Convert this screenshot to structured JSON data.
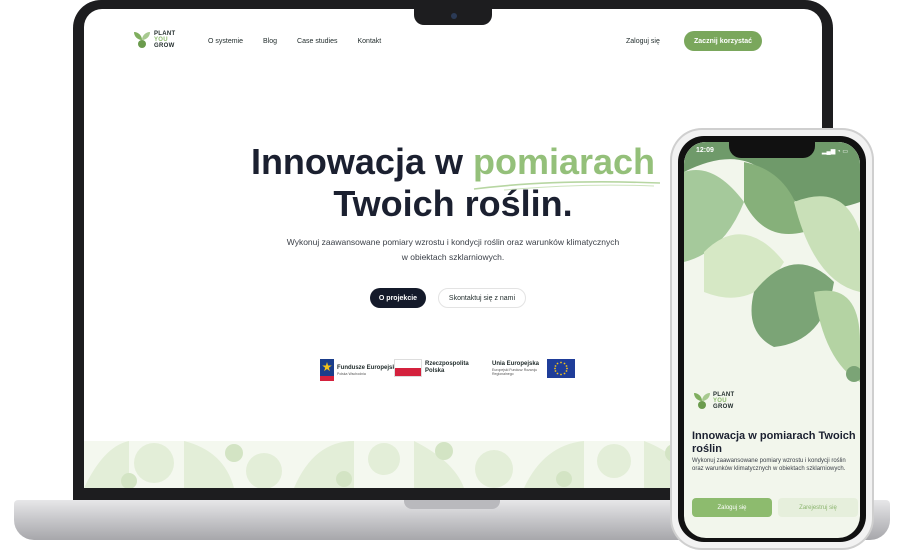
{
  "brand": {
    "line1": "PLANT",
    "line2": "YOU",
    "line3": "GROW"
  },
  "nav": {
    "items": [
      "O systemie",
      "Blog",
      "Case studies",
      "Kontakt"
    ],
    "login": "Zaloguj się",
    "cta": "Zacznij korzystać"
  },
  "hero": {
    "title_part1": "Innowacja w ",
    "title_accent": "pomiarach",
    "title_line2": "Twoich roślin.",
    "subtitle": "Wykonuj zaawansowane pomiary wzrostu i kondycji roślin oraz warunków klimatycznych w obiektach szklarniowych.",
    "primary_button": "O projekcie",
    "secondary_button": "Skontaktuj się z nami"
  },
  "funding": {
    "fe_title": "Fundusze Europejskie",
    "fe_sub": "Polska Wschodnia",
    "pl_title": "Rzeczpospolita Polska",
    "eu_title": "Unia Europejska",
    "eu_sub": "Europejski Fundusz Rozwoju Regionalnego"
  },
  "phone": {
    "time": "12:09",
    "status": "▂▄▆ ◔ ▭",
    "title": "Innowacja w pomiarach Twoich roślin",
    "subtitle": "Wykonuj zaawansowane pomiary wzrostu i kondycji roślin oraz warunków klimatycznych w obiektach szklarniowych.",
    "login_button": "Zaloguj się",
    "register_button": "Zarejestruj się"
  },
  "colors": {
    "accent": "#94c07a",
    "cta": "#7aa75c",
    "dark": "#141a2a"
  }
}
